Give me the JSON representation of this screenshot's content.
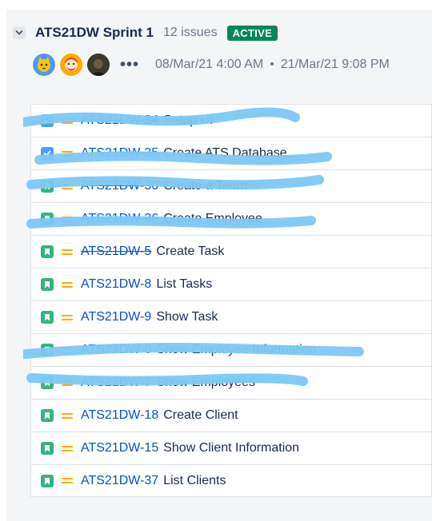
{
  "sprint": {
    "title": "ATS21DW Sprint 1",
    "issue_count": "12 issues",
    "status": "ACTIVE",
    "start_date": "08/Mar/21 4:00 AM",
    "separator": "•",
    "end_date": "21/Mar/21 9:08 PM",
    "more_label": "•••"
  },
  "colors": {
    "active_badge": "#00875a",
    "issue_key": "#0052cc",
    "story_icon": "#36b37e",
    "task_icon": "#4c9aff",
    "priority_medium": "#ffab00",
    "redaction": "#7cc8f6"
  },
  "issues": [
    {
      "key": "ATS21DW-34",
      "summary": "Setup UI",
      "type": "task",
      "done": true
    },
    {
      "key": "ATS21DW-35",
      "summary": "Create ATS Database",
      "type": "task",
      "done": true
    },
    {
      "key": "ATS21DW-30",
      "summary": "Create a Team",
      "type": "story",
      "done": true
    },
    {
      "key": "ATS21DW-36",
      "summary": "Create Employee",
      "type": "story",
      "done": true
    },
    {
      "key": "ATS21DW-5",
      "summary": "Create Task",
      "type": "story",
      "done": true
    },
    {
      "key": "ATS21DW-8",
      "summary": "List Tasks",
      "type": "story",
      "done": false
    },
    {
      "key": "ATS21DW-9",
      "summary": "Show Task",
      "type": "story",
      "done": false
    },
    {
      "key": "ATS21DW-6",
      "summary": "Show Employee Information",
      "type": "story",
      "done": false
    },
    {
      "key": "ATS21DW-7",
      "summary": "Show Employees",
      "type": "story",
      "done": false
    },
    {
      "key": "ATS21DW-18",
      "summary": "Create Client",
      "type": "story",
      "done": false
    },
    {
      "key": "ATS21DW-15",
      "summary": "Show Client Information",
      "type": "story",
      "done": false
    },
    {
      "key": "ATS21DW-37",
      "summary": "List Clients",
      "type": "story",
      "done": false
    }
  ]
}
